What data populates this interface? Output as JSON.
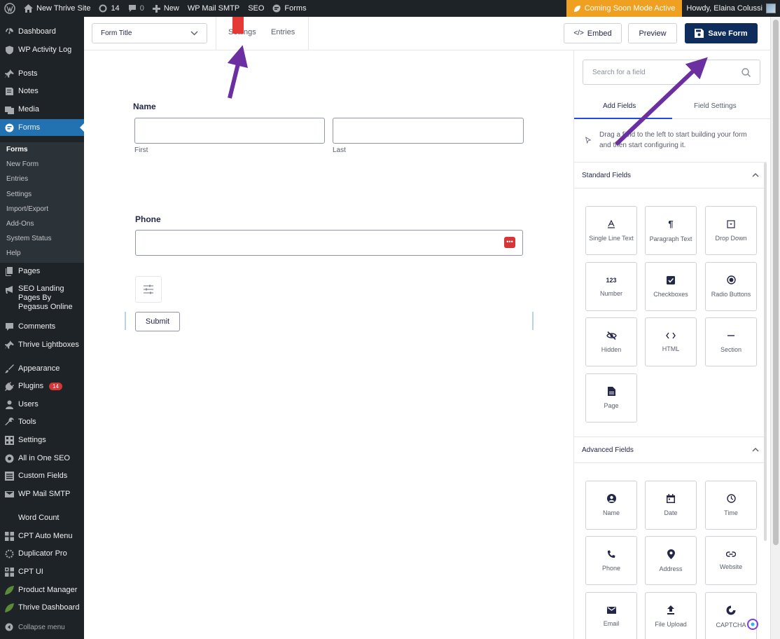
{
  "adminbar": {
    "site_name": "New Thrive Site",
    "updates_count": "14",
    "comments_count": "0",
    "new_label": "New",
    "wp_mail_smtp": "WP Mail SMTP",
    "seo": "SEO",
    "forms": "Forms",
    "coming_soon": "Coming Soon Mode Active",
    "howdy": "Howdy, Elaina Colussi"
  },
  "sidebar": {
    "items": [
      {
        "label": "Dashboard",
        "icon": "dashboard-icon"
      },
      {
        "label": "WP Activity Log",
        "icon": "shield-icon"
      },
      {
        "label": "Posts",
        "icon": "pin-icon"
      },
      {
        "label": "Notes",
        "icon": "notes-icon"
      },
      {
        "label": "Media",
        "icon": "media-icon"
      },
      {
        "label": "Forms",
        "icon": "forms-icon"
      },
      {
        "label": "Pages",
        "icon": "pages-icon"
      },
      {
        "label": "SEO Landing Pages By Pegasus Online",
        "icon": "megaphone-icon"
      },
      {
        "label": "Comments",
        "icon": "comments-icon"
      },
      {
        "label": "Thrive Lightboxes",
        "icon": "pin-icon"
      },
      {
        "label": "Appearance",
        "icon": "appearance-icon"
      },
      {
        "label": "Plugins",
        "icon": "plugins-icon"
      },
      {
        "label": "Users",
        "icon": "users-icon"
      },
      {
        "label": "Tools",
        "icon": "tools-icon"
      },
      {
        "label": "Settings",
        "icon": "settings-icon"
      },
      {
        "label": "All in One SEO",
        "icon": "aioseo-icon"
      },
      {
        "label": "Custom Fields",
        "icon": "custom-fields-icon"
      },
      {
        "label": "WP Mail SMTP",
        "icon": "mail-icon"
      },
      {
        "label": "Word Count",
        "icon": ""
      },
      {
        "label": "CPT Auto Menu",
        "icon": "grid-icon"
      },
      {
        "label": "Duplicator Pro",
        "icon": "duplicator-icon"
      },
      {
        "label": "CPT UI",
        "icon": "cptui-icon"
      },
      {
        "label": "Product Manager",
        "icon": "leaf-icon"
      },
      {
        "label": "Thrive Dashboard",
        "icon": "leaf-icon"
      },
      {
        "label": "Collapse menu",
        "icon": "collapse-icon"
      }
    ],
    "plugins_badge": "14",
    "submenu": [
      "Forms",
      "New Form",
      "Entries",
      "Settings",
      "Import/Export",
      "Add-Ons",
      "System Status",
      "Help"
    ]
  },
  "toolbar": {
    "form_title": "Form Title",
    "tab_settings": "Settings",
    "tab_entries": "Entries",
    "embed": "Embed",
    "preview": "Preview",
    "save": "Save Form"
  },
  "canvas": {
    "name_label": "Name",
    "first_label": "First",
    "last_label": "Last",
    "phone_label": "Phone",
    "submit": "Submit"
  },
  "panel": {
    "search_placeholder": "Search for a field",
    "tab_add": "Add Fields",
    "tab_settings": "Field Settings",
    "hint": "Drag a field to the left to start building your form and then start configuring it.",
    "standard_title": "Standard Fields",
    "advanced_title": "Advanced Fields",
    "standard_fields": [
      "Single Line Text",
      "Paragraph Text",
      "Drop Down",
      "Number",
      "Checkboxes",
      "Radio Buttons",
      "Hidden",
      "HTML",
      "Section",
      "Page"
    ],
    "advanced_fields": [
      "Name",
      "Date",
      "Time",
      "Phone",
      "Address",
      "Website",
      "Email",
      "File Upload",
      "CAPTCHA"
    ]
  },
  "colors": {
    "accent": "#0f2d5c",
    "admin_bar": "#1d2327",
    "active_menu": "#2271b1",
    "arrow": "#6b2fa1",
    "coming_soon": "#f0a020"
  }
}
